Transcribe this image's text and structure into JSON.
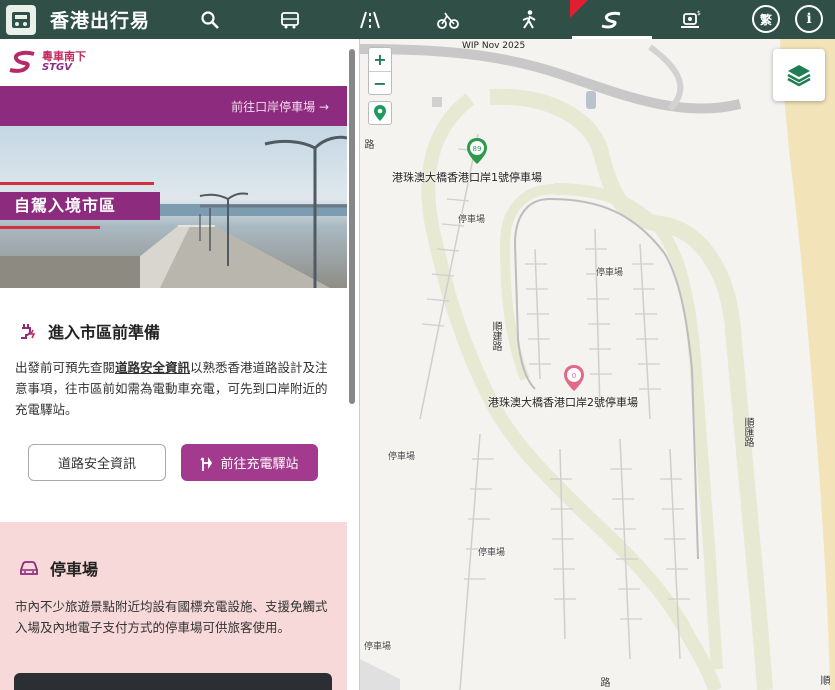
{
  "app": {
    "title": "香港出行易"
  },
  "topbar": {
    "nav": [
      "search-icon",
      "bus-icon",
      "road-icon",
      "bike-icon",
      "walk-icon",
      "ev-charge-icon",
      "ferry-icon"
    ],
    "lang_button": "繁",
    "info_button": "i"
  },
  "panel": {
    "brand_cn": "粵車南下",
    "brand_en": "STGV",
    "banner_link": "前往口岸停車場 →",
    "hero_caption": "自駕入境市區",
    "prep": {
      "title": "進入市區前準備",
      "text_before": "出發前可預先查閱",
      "text_link": "道路安全資訊",
      "text_after": "以熟悉香港道路設計及注意事項，往市區前如需為電動車充電，可先到口岸附近的充電驛站。",
      "btn_road_safety": "道路安全資訊",
      "btn_charging": "前往充電驛站"
    },
    "parking": {
      "title": "停車場",
      "text": "市內不少旅遊景點附近均設有國標充電設施、支援免觸式入場及內地電子支付方式的停車場可供旅客使用。"
    }
  },
  "map": {
    "wip": "WIP Nov 2025",
    "zoom_in": "+",
    "zoom_out": "−",
    "carpark1": "港珠澳大橋香港口岸1號停車場",
    "carpark2": "港珠澳大橋香港口岸2號停車場",
    "pin1": "89",
    "pin2": "0",
    "lot_label": "停車場",
    "road_shun_kin": "順建路",
    "road_shun_kin_2": "順建路",
    "road_shun_fai": "順匯路",
    "road_edge1": "路",
    "road_edge2": "路",
    "road_edge3": "順"
  },
  "colors": {
    "topbar": "#2f4f47",
    "brand_purple": "#8d2b7e",
    "button_purple": "#a33a8d",
    "pink_bg": "#f6d9d8",
    "map_bg": "#f4f3ef"
  }
}
